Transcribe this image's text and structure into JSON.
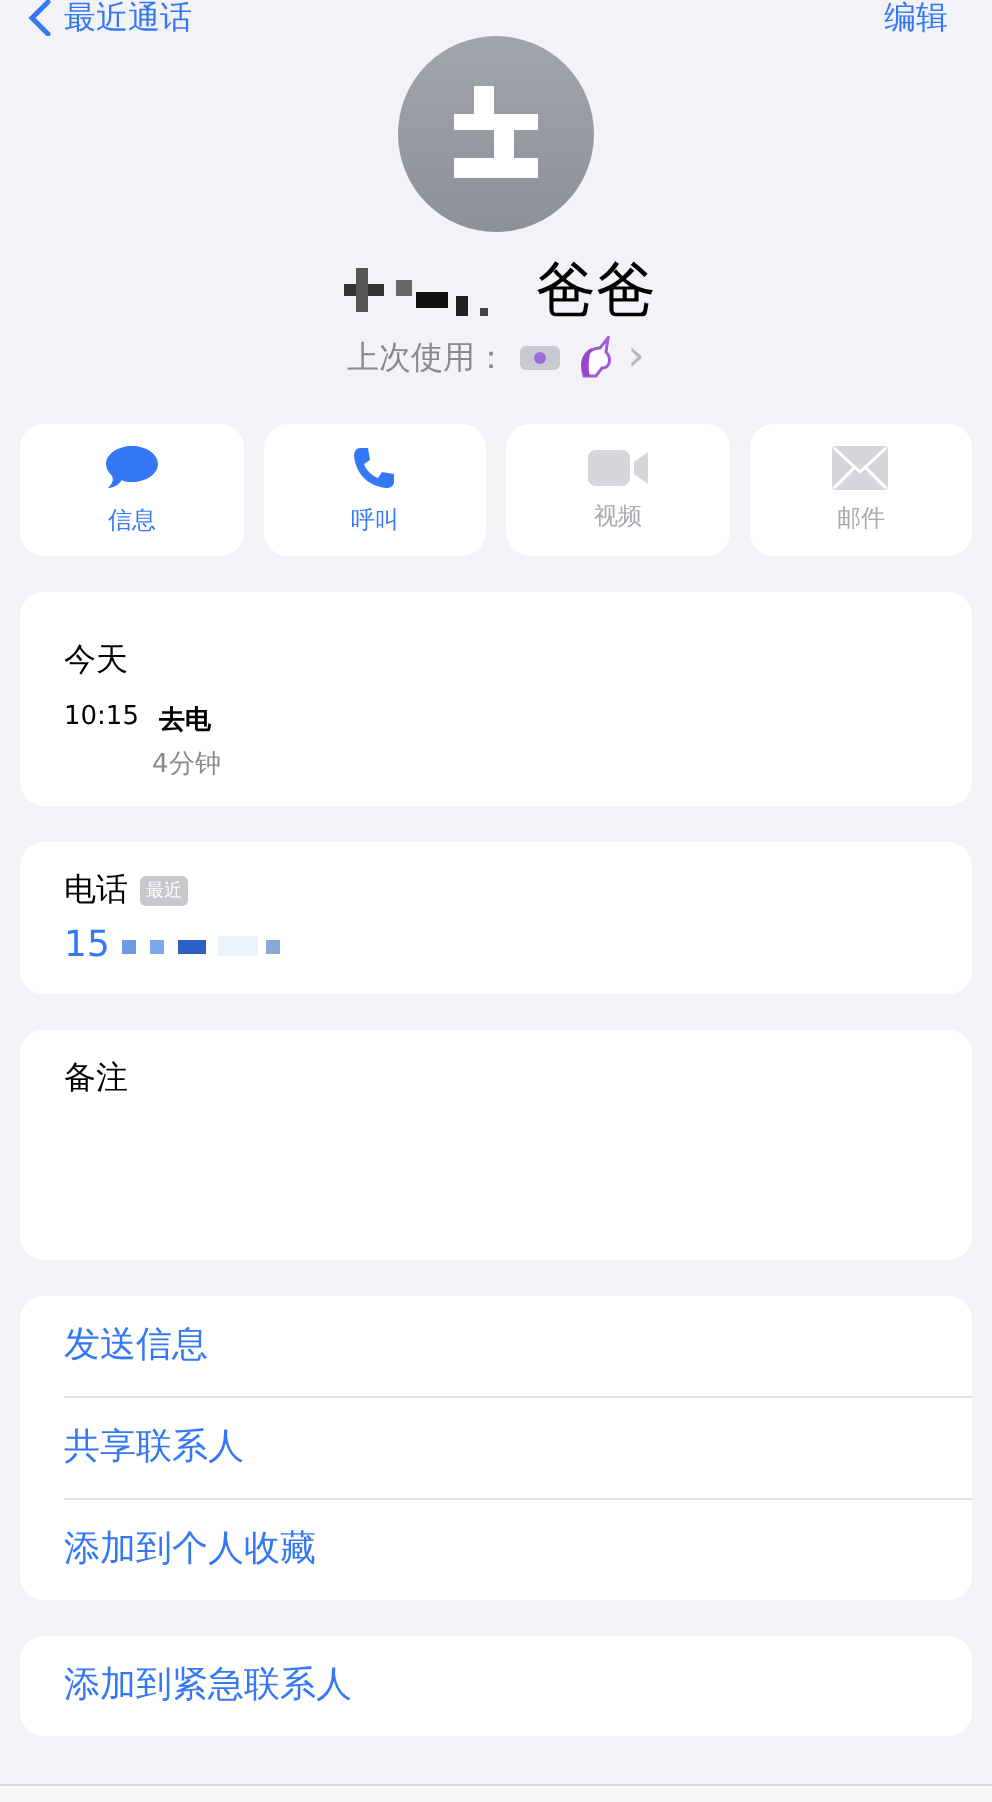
{
  "nav": {
    "back": "最近通话",
    "edit": "编辑"
  },
  "contact": {
    "name": "爸爸",
    "last_used_label": "上次使用：",
    "chevron": "›"
  },
  "actions": [
    {
      "kind": "message",
      "label": "信息",
      "disabled": false
    },
    {
      "kind": "call",
      "label": "呼叫",
      "disabled": false
    },
    {
      "kind": "video",
      "label": "视频",
      "disabled": true
    },
    {
      "kind": "mail",
      "label": "邮件",
      "disabled": true
    }
  ],
  "history": {
    "title": "今天",
    "time": "10:15",
    "type": "去电",
    "duration": "4分钟"
  },
  "phone": {
    "label": "电话",
    "badge": "最近",
    "number": "15"
  },
  "notes": {
    "label": "备注"
  },
  "links": [
    "发送信息",
    "共享联系人",
    "添加到个人收藏"
  ],
  "emergency": "添加到紧急联系人"
}
